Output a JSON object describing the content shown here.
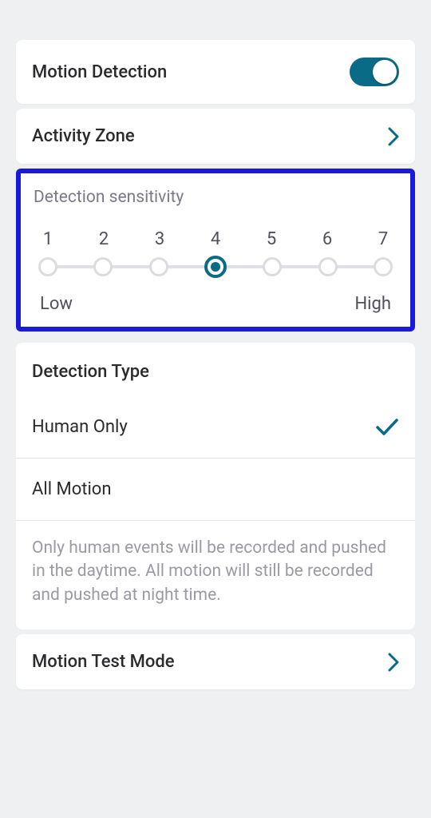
{
  "colors": {
    "accent": "#0a6b86",
    "highlightBorder": "#1a1adf"
  },
  "motionDetection": {
    "label": "Motion Detection",
    "enabled": true
  },
  "activityZone": {
    "label": "Activity Zone"
  },
  "sensitivity": {
    "title": "Detection sensitivity",
    "steps": [
      "1",
      "2",
      "3",
      "4",
      "5",
      "6",
      "7"
    ],
    "selected": 4,
    "lowLabel": "Low",
    "highLabel": "High"
  },
  "detectionType": {
    "header": "Detection Type",
    "options": [
      {
        "label": "Human Only",
        "selected": true
      },
      {
        "label": "All Motion",
        "selected": false
      }
    ],
    "description": "Only human events will be recorded and pushed in the daytime. All motion will still be recorded and pushed at night time."
  },
  "motionTest": {
    "label": "Motion Test Mode"
  }
}
